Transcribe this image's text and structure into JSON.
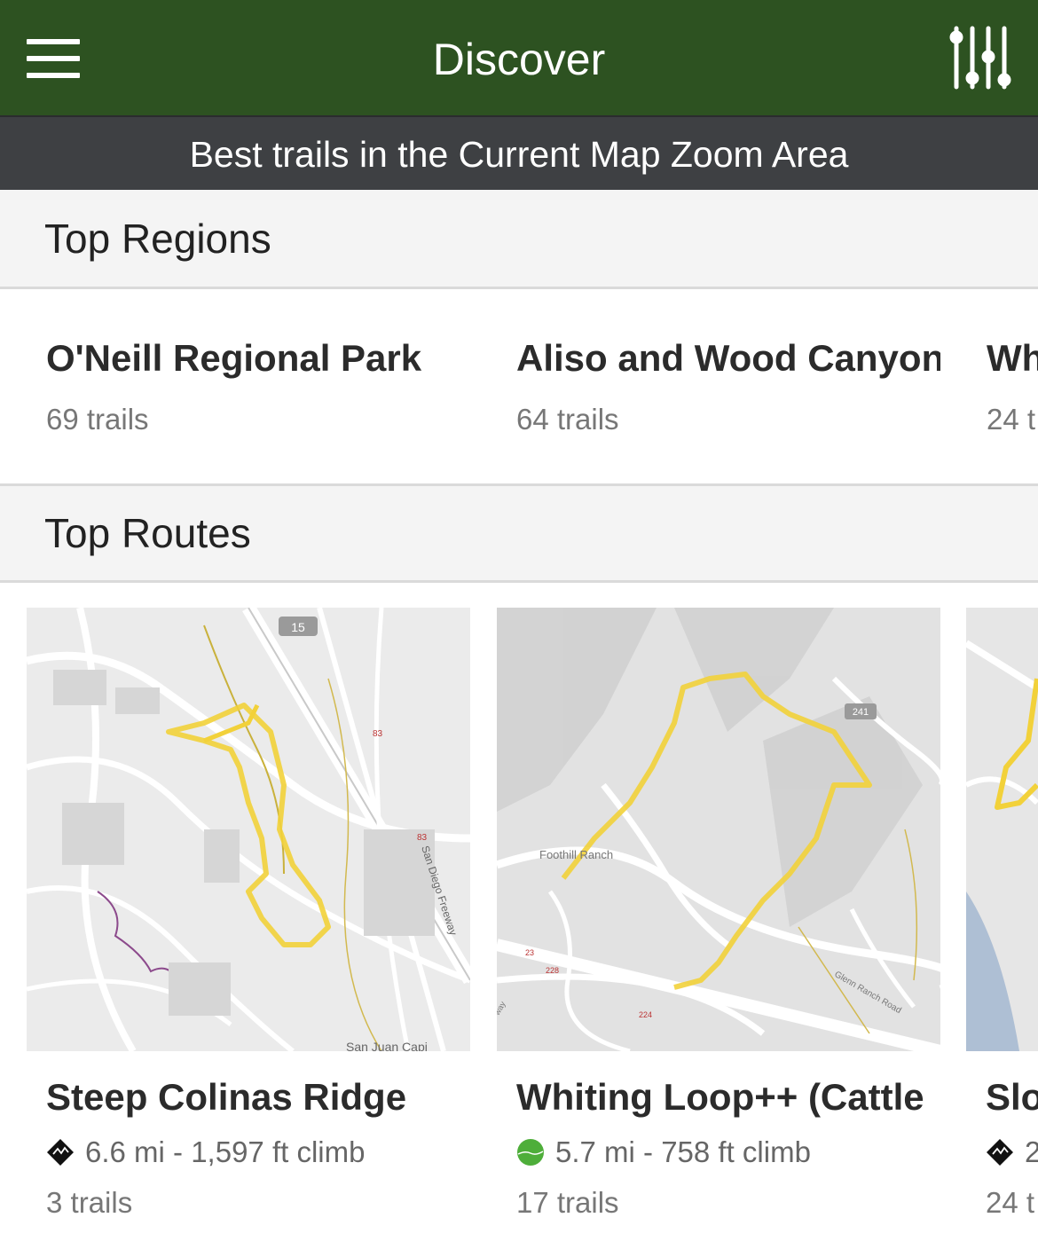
{
  "header": {
    "title": "Discover",
    "menu_icon": "hamburger-menu-icon",
    "filter_icon": "sliders-filter-icon",
    "bg_color": "#2d5221"
  },
  "subheader": {
    "text": "Best trails in the Current Map Zoom Area"
  },
  "regions": {
    "title": "Top Regions",
    "items": [
      {
        "name": "O'Neill Regional Park",
        "count": "69 trails"
      },
      {
        "name": "Aliso and Wood Canyon",
        "count": "64 trails"
      },
      {
        "name": "Wh",
        "count": "24 t"
      }
    ]
  },
  "routes": {
    "title": "Top Routes",
    "items": [
      {
        "name": "Steep Colinas Ridge",
        "difficulty": "black-diamond-icon",
        "stats": "6.6 mi - 1,597 ft climb",
        "trails": "3 trails",
        "map_labels": [
          "15",
          "83",
          "83",
          "San Diego Freeway",
          "San Juan Capi"
        ]
      },
      {
        "name": "Whiting Loop++ (Cattle",
        "difficulty": "green-circle-icon",
        "stats": "5.7 mi - 758 ft climb",
        "trails": "17 trails",
        "map_labels": [
          "Foothill Ranch",
          "241",
          "23",
          "228",
          "224",
          "Glenn Ranch Road",
          "way"
        ]
      },
      {
        "name": "Slo",
        "difficulty": "black-diamond-icon",
        "stats": "2",
        "trails": "24 t"
      }
    ]
  }
}
